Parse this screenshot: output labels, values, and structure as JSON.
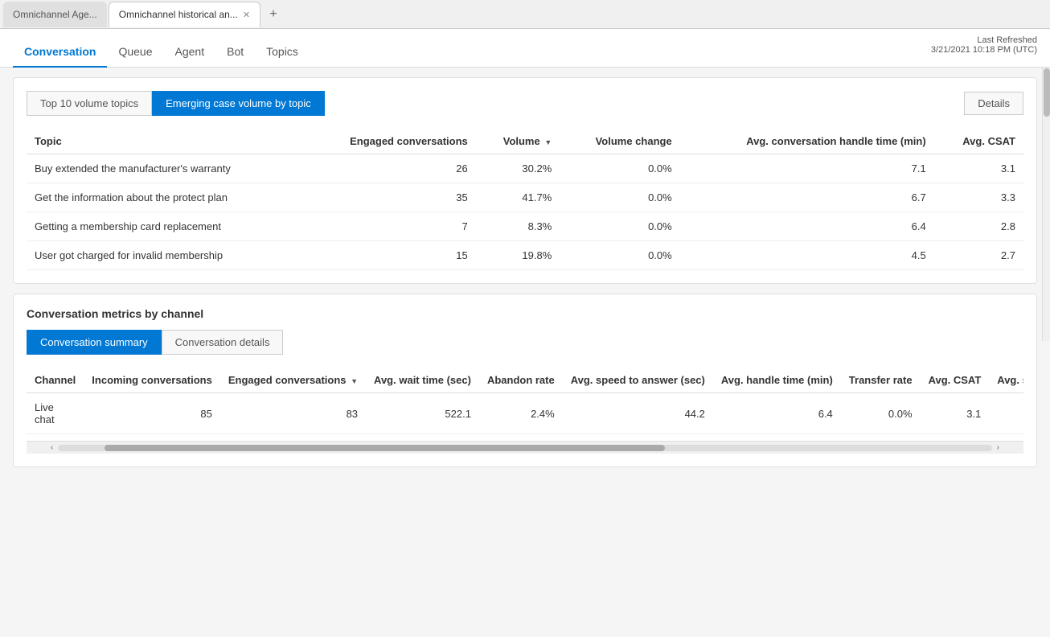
{
  "browser": {
    "tabs": [
      {
        "label": "Omnichannel Age...",
        "active": false
      },
      {
        "label": "Omnichannel historical an...",
        "active": true
      }
    ],
    "add_tab_icon": "+"
  },
  "navbar": {
    "items": [
      "Conversation",
      "Queue",
      "Agent",
      "Bot",
      "Topics"
    ],
    "active_item": "Conversation",
    "last_refreshed_label": "Last Refreshed",
    "last_refreshed_value": "3/21/2021 10:18 PM (UTC)"
  },
  "topics_section": {
    "tabs": [
      {
        "label": "Top 10 volume topics",
        "active": false
      },
      {
        "label": "Emerging case volume by topic",
        "active": true
      }
    ],
    "details_button": "Details",
    "columns": [
      {
        "label": "Topic",
        "align": "left"
      },
      {
        "label": "Engaged conversations",
        "align": "right"
      },
      {
        "label": "Volume",
        "align": "right",
        "sort": true
      },
      {
        "label": "Volume change",
        "align": "right"
      },
      {
        "label": "Avg. conversation handle time (min)",
        "align": "right"
      },
      {
        "label": "Avg. CSAT",
        "align": "right"
      }
    ],
    "rows": [
      {
        "topic": "Buy extended the manufacturer's warranty",
        "engaged_conversations": "26",
        "volume": "30.2%",
        "volume_change": "0.0%",
        "avg_handle_time": "7.1",
        "avg_csat": "3.1"
      },
      {
        "topic": "Get the information about the protect plan",
        "engaged_conversations": "35",
        "volume": "41.7%",
        "volume_change": "0.0%",
        "avg_handle_time": "6.7",
        "avg_csat": "3.3"
      },
      {
        "topic": "Getting a membership card replacement",
        "engaged_conversations": "7",
        "volume": "8.3%",
        "volume_change": "0.0%",
        "avg_handle_time": "6.4",
        "avg_csat": "2.8"
      },
      {
        "topic": "User got charged for invalid membership",
        "engaged_conversations": "15",
        "volume": "19.8%",
        "volume_change": "0.0%",
        "avg_handle_time": "4.5",
        "avg_csat": "2.7"
      }
    ]
  },
  "metrics_section": {
    "section_title": "Conversation metrics by channel",
    "tabs": [
      {
        "label": "Conversation summary",
        "active": true
      },
      {
        "label": "Conversation details",
        "active": false
      }
    ],
    "columns": [
      {
        "label": "Channel",
        "align": "left"
      },
      {
        "label": "Incoming conversations",
        "align": "right"
      },
      {
        "label": "Engaged conversations",
        "align": "right",
        "sort": true
      },
      {
        "label": "Avg. wait time (sec)",
        "align": "right"
      },
      {
        "label": "Abandon rate",
        "align": "right"
      },
      {
        "label": "Avg. speed to answer (sec)",
        "align": "right"
      },
      {
        "label": "Avg. handle time (min)",
        "align": "right"
      },
      {
        "label": "Transfer rate",
        "align": "right"
      },
      {
        "label": "Avg. CSAT",
        "align": "right"
      },
      {
        "label": "Avg. survey se",
        "align": "right"
      }
    ],
    "rows": [
      {
        "channel": "Live chat",
        "incoming": "85",
        "engaged": "83",
        "avg_wait": "522.1",
        "abandon_rate": "2.4%",
        "avg_speed": "44.2",
        "avg_handle": "6.4",
        "transfer_rate": "0.0%",
        "avg_csat": "3.1",
        "avg_survey": ""
      }
    ]
  }
}
